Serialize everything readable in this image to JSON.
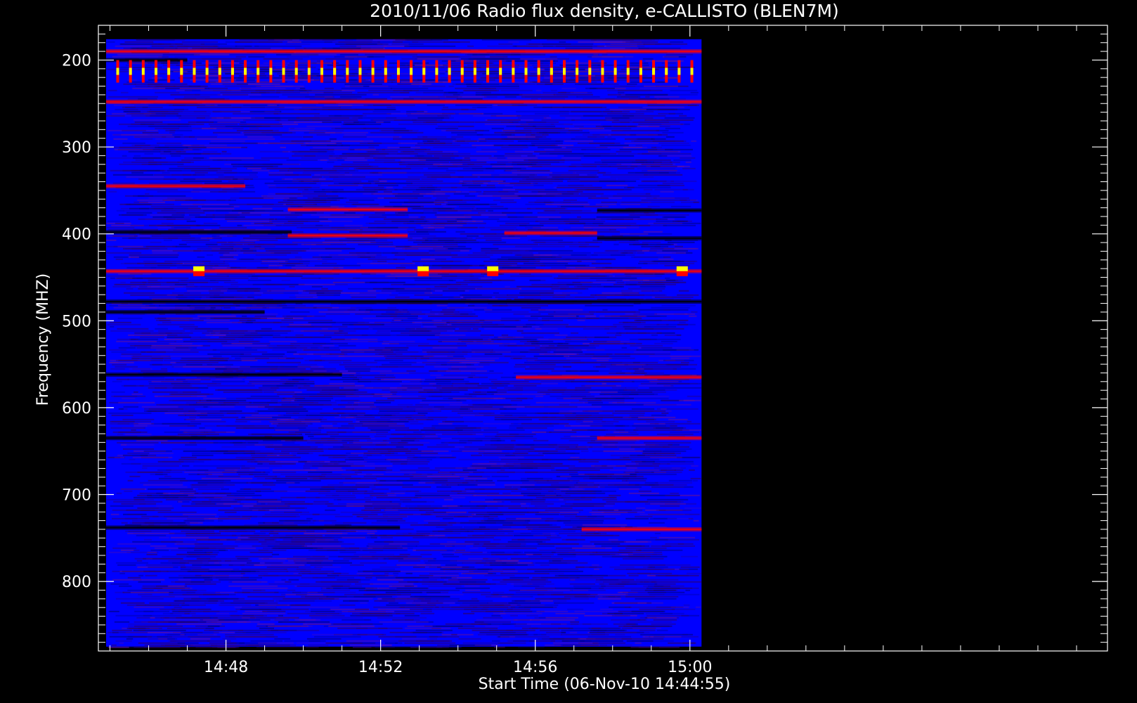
{
  "chart_data": {
    "type": "heatmap",
    "title": "2010/11/06  Radio flux density, e-CALLISTO (BLEN7M)",
    "xlabel": "Start Time (06-Nov-10 14:44:55)",
    "ylabel": "Frequency (MHZ)",
    "x_ticks": [
      "14:48",
      "14:52",
      "14:56",
      "15:00"
    ],
    "x_tick_minutes": [
      228,
      232,
      236,
      240
    ],
    "y_ticks": [
      200,
      300,
      400,
      500,
      600,
      700,
      800
    ],
    "xlim_minutes": [
      224.7,
      250.8
    ],
    "data_time_range_minutes": [
      224.9,
      240.3
    ],
    "ylim_mhz": [
      880,
      160
    ],
    "data_freq_range_mhz": [
      176,
      875
    ],
    "colormap": [
      "#000000",
      "#0000ff",
      "#ff0000",
      "#ffff00"
    ],
    "background_level": "blue",
    "features": [
      {
        "kind": "dark_band",
        "freq_mhz": 200,
        "t_start": 224.9,
        "t_end": 227.0
      },
      {
        "kind": "red_band",
        "freq_mhz": 190,
        "t_start": 224.9,
        "t_end": 240.3
      },
      {
        "kind": "red_band",
        "freq_mhz": 248,
        "t_start": 224.9,
        "t_end": 240.3
      },
      {
        "kind": "red_band",
        "freq_mhz": 345,
        "t_start": 224.9,
        "t_end": 228.5
      },
      {
        "kind": "dark_band",
        "freq_mhz": 398,
        "t_start": 224.9,
        "t_end": 229.7
      },
      {
        "kind": "red_band",
        "freq_mhz": 372,
        "t_start": 229.6,
        "t_end": 232.7
      },
      {
        "kind": "red_band",
        "freq_mhz": 402,
        "t_start": 229.6,
        "t_end": 232.7
      },
      {
        "kind": "red_band",
        "freq_mhz": 399,
        "t_start": 235.2,
        "t_end": 237.6
      },
      {
        "kind": "dark_band",
        "freq_mhz": 405,
        "t_start": 237.6,
        "t_end": 240.3
      },
      {
        "kind": "dark_band",
        "freq_mhz": 373,
        "t_start": 237.6,
        "t_end": 240.3
      },
      {
        "kind": "red_band",
        "freq_mhz": 443,
        "t_start": 224.9,
        "t_end": 240.3
      },
      {
        "kind": "dark_band",
        "freq_mhz": 478,
        "t_start": 224.9,
        "t_end": 240.3
      },
      {
        "kind": "dark_band",
        "freq_mhz": 490,
        "t_start": 224.9,
        "t_end": 229.0
      },
      {
        "kind": "dark_band",
        "freq_mhz": 562,
        "t_start": 224.9,
        "t_end": 231.0
      },
      {
        "kind": "red_band",
        "freq_mhz": 565,
        "t_start": 235.5,
        "t_end": 240.3
      },
      {
        "kind": "red_band",
        "freq_mhz": 635,
        "t_start": 237.6,
        "t_end": 240.3
      },
      {
        "kind": "dark_band",
        "freq_mhz": 635,
        "t_start": 224.9,
        "t_end": 230.0
      },
      {
        "kind": "dark_band",
        "freq_mhz": 738,
        "t_start": 224.9,
        "t_end": 232.5
      },
      {
        "kind": "red_band",
        "freq_mhz": 740,
        "t_start": 237.2,
        "t_end": 240.3
      },
      {
        "kind": "hot_spot",
        "freq_mhz": 443,
        "t": 233.1
      },
      {
        "kind": "hot_spot",
        "freq_mhz": 443,
        "t": 234.9
      },
      {
        "kind": "hot_spot",
        "freq_mhz": 443,
        "t": 227.3
      },
      {
        "kind": "hot_spot",
        "freq_mhz": 443,
        "t": 239.8
      },
      {
        "kind": "periodic_bursts",
        "freq_mhz": 213,
        "t_start": 225.2,
        "t_end": 240.3,
        "period_min": 0.33
      }
    ]
  }
}
